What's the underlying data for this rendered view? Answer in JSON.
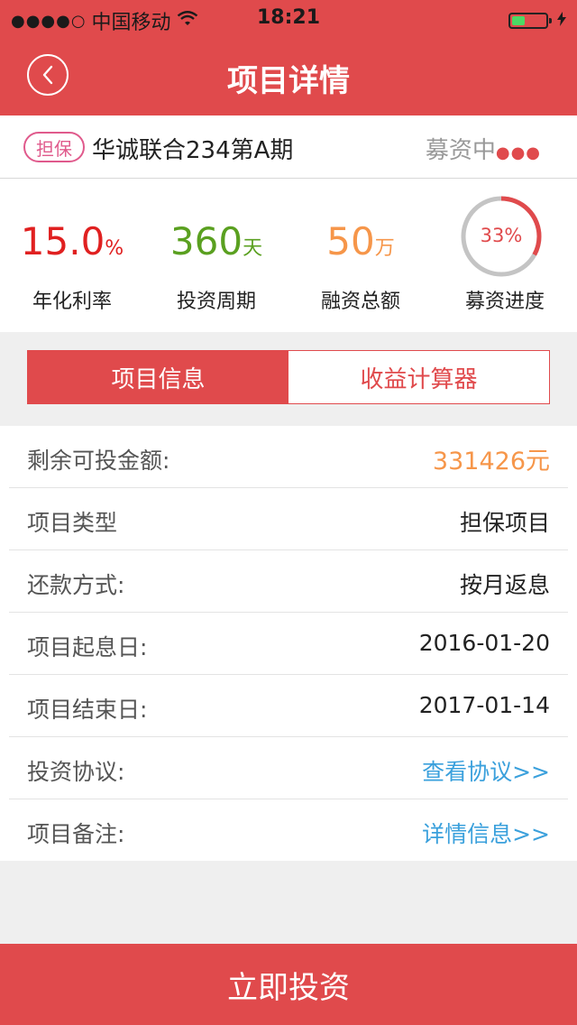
{
  "status_bar": {
    "signal": "●●●●○",
    "carrier": "中国移动",
    "wifi_icon": "wifi-icon",
    "time": "18:21",
    "battery_level": 0.4
  },
  "nav": {
    "back_icon": "chevron-left-icon",
    "title": "项目详情"
  },
  "project": {
    "badge": "担保",
    "name": "华诚联合234第A期",
    "status": "募资中"
  },
  "stats": {
    "rate": {
      "value": "15.0",
      "unit": "%",
      "label": "年化利率",
      "color": "#e02020"
    },
    "period": {
      "value": "360",
      "unit": "天",
      "label": "投资周期",
      "color": "#5aa020"
    },
    "total": {
      "value": "50",
      "unit": "万",
      "label": "融资总额",
      "color": "#f6964a"
    },
    "progress": {
      "value": "33%",
      "fraction": 0.33,
      "label": "募资进度"
    }
  },
  "tabs": [
    {
      "label": "项目信息",
      "active": true
    },
    {
      "label": "收益计算器",
      "active": false
    }
  ],
  "info": [
    {
      "key": "剩余可投金额:",
      "value": "331426元"
    },
    {
      "key": "项目类型",
      "value": "担保项目"
    },
    {
      "key": "还款方式:",
      "value": "按月返息"
    },
    {
      "key": "项目起息日:",
      "value": "2016-01-20"
    },
    {
      "key": "项目结束日:",
      "value": "2017-01-14"
    },
    {
      "key": "投资协议:",
      "value": "查看协议>>"
    },
    {
      "key": "项目备注:",
      "value": "详情信息>>"
    }
  ],
  "invest_button": "立即投资",
  "colors": {
    "brand_red": "#e04a4c",
    "orange": "#f6964a",
    "link_blue": "#3aa0dc"
  }
}
